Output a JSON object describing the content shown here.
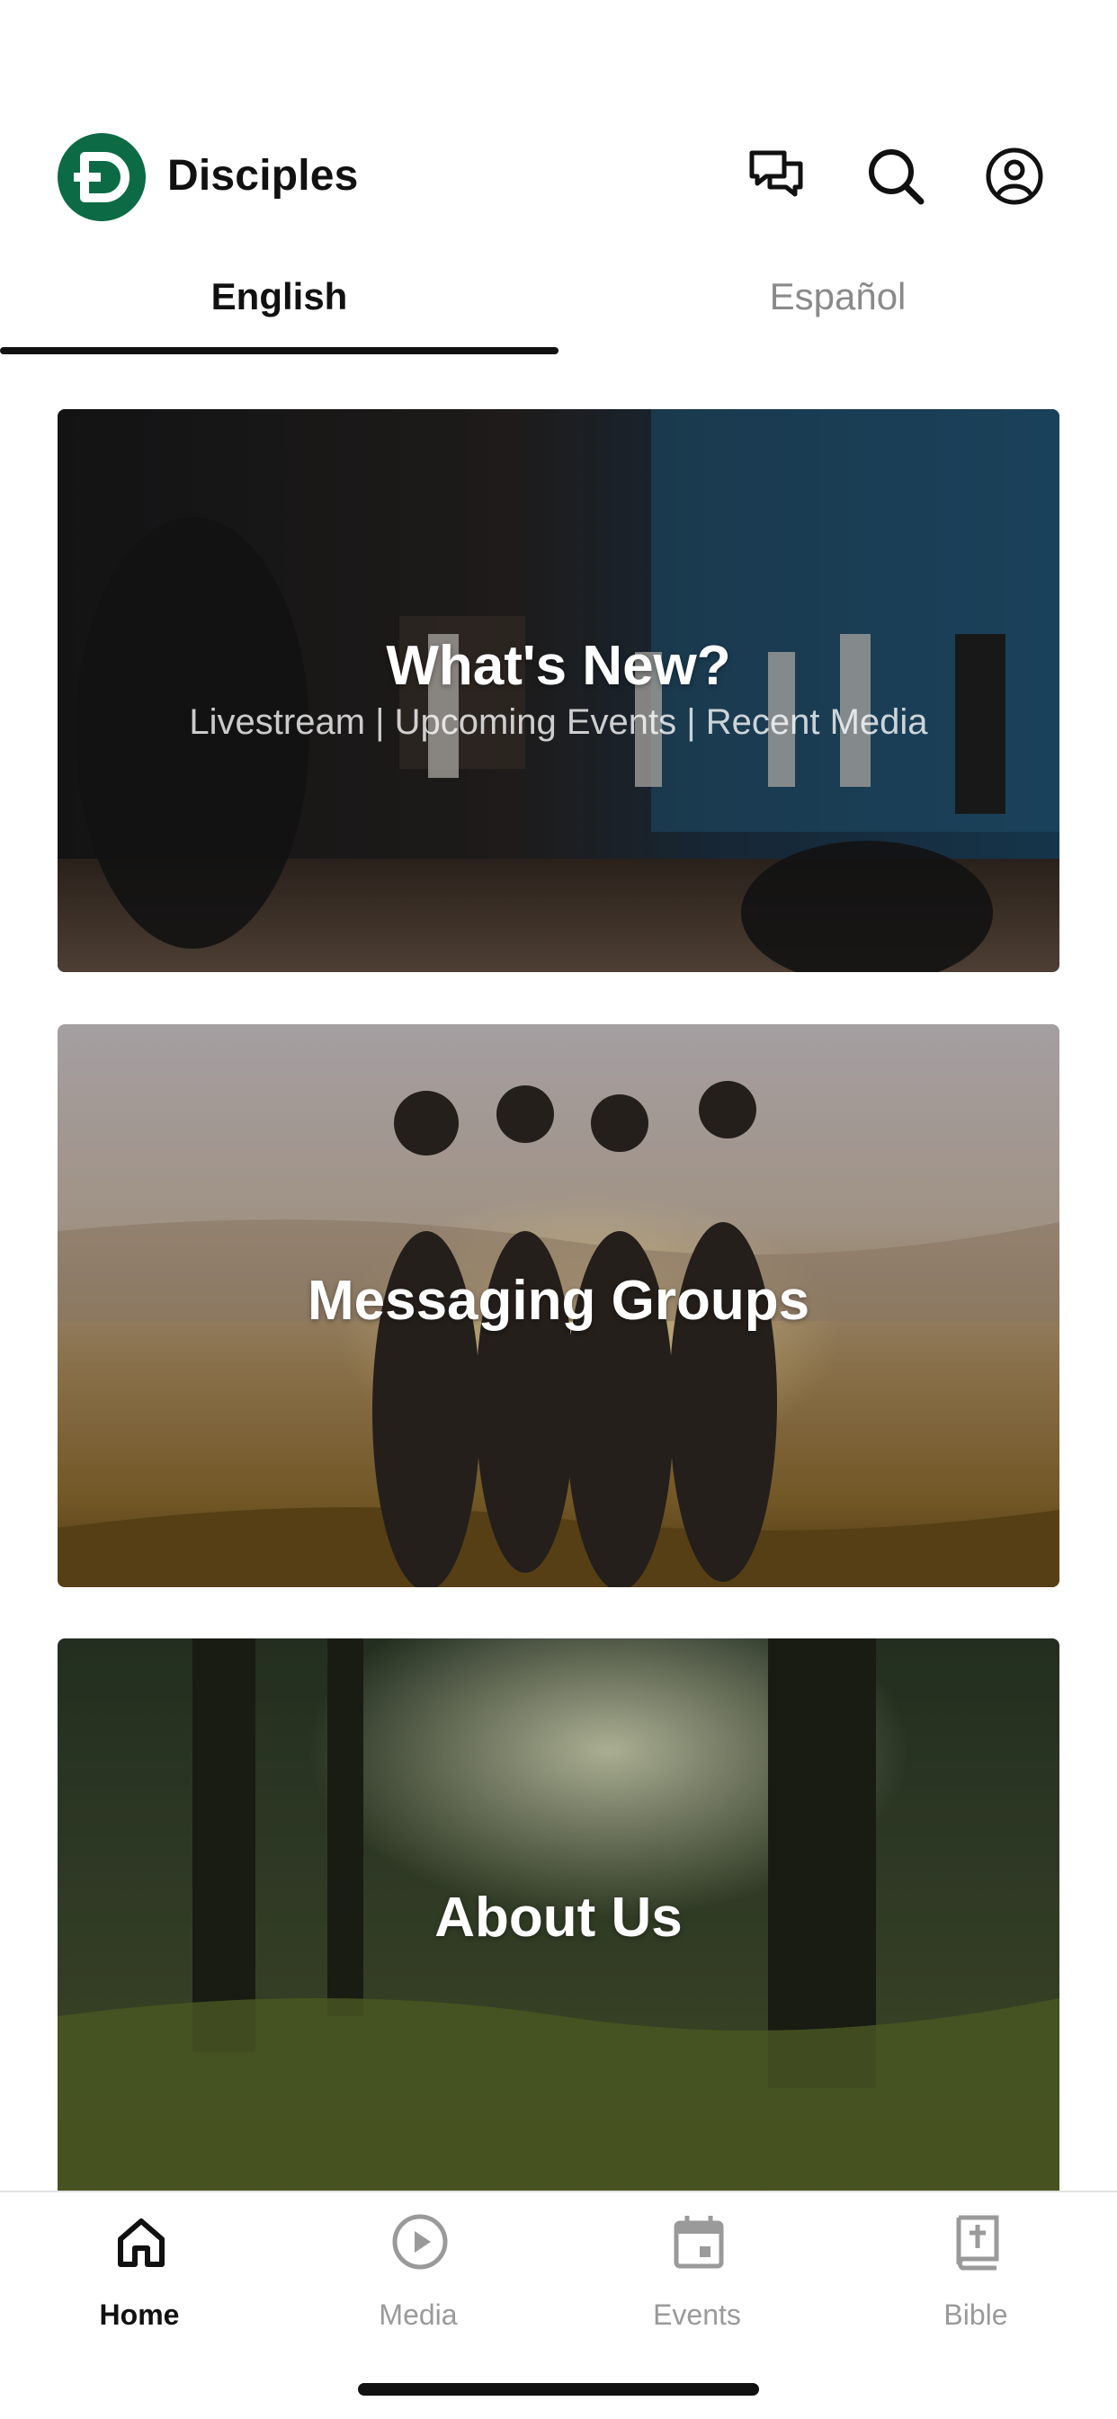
{
  "app": {
    "title": "Disciples",
    "brand_color": "#0c6b45"
  },
  "header": {
    "icons": [
      "chat-icon",
      "search-icon",
      "profile-icon"
    ]
  },
  "tabs": [
    {
      "label": "English",
      "active": true
    },
    {
      "label": "Español",
      "active": false
    }
  ],
  "cards": [
    {
      "title": "What's New?",
      "subtitle": "Livestream | Upcoming Events | Recent Media"
    },
    {
      "title": "Messaging Groups"
    },
    {
      "title": "About Us"
    }
  ],
  "bottom_nav": [
    {
      "label": "Home",
      "icon": "home-icon",
      "active": true
    },
    {
      "label": "Media",
      "icon": "play-icon",
      "active": false
    },
    {
      "label": "Events",
      "icon": "calendar-icon",
      "active": false
    },
    {
      "label": "Bible",
      "icon": "bible-icon",
      "active": false
    }
  ]
}
